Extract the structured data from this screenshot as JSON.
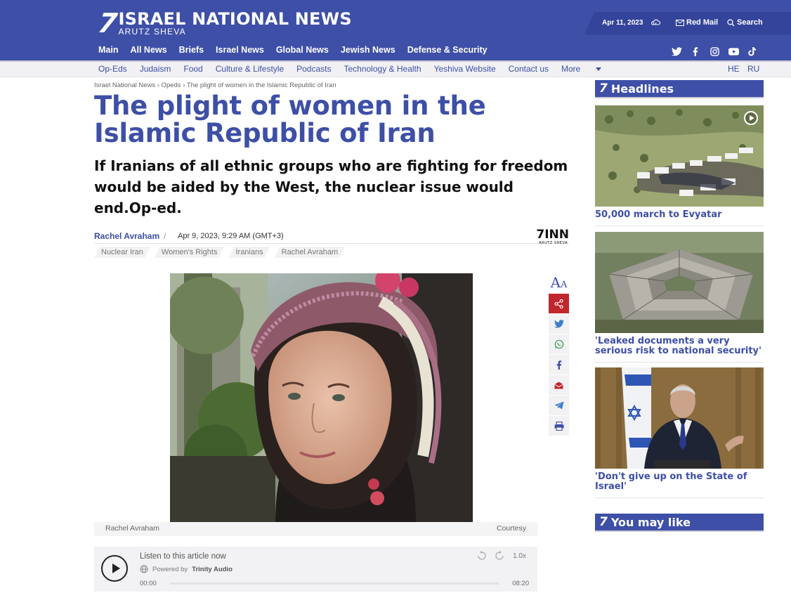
{
  "header": {
    "logo_main": "ISRAEL NATIONAL NEWS",
    "logo_sub": "ARUTZ SHEVA",
    "date": "Apr 11, 2023",
    "red_mail": "Red Mail",
    "search": "Search",
    "brand_color": "#3d4fa6",
    "main_nav": [
      "Main",
      "All News",
      "Briefs",
      "Israel News",
      "Global News",
      "Jewish News",
      "Defense & Security"
    ],
    "socials": [
      "twitter-icon",
      "facebook-icon",
      "instagram-icon",
      "youtube-icon",
      "tiktok-icon"
    ]
  },
  "subnav": {
    "items": [
      "Op-Eds",
      "Judaism",
      "Food",
      "Culture & Lifestyle",
      "Podcasts",
      "Technology & Health",
      "Yeshiva Website",
      "Contact us",
      "More"
    ],
    "lang_he": "HE",
    "lang_ru": "RU"
  },
  "article": {
    "breadcrumb": "Israel National News › Opeds › The plight of women in the Islamic Republic of Iran",
    "title": "The plight of women in the Islamic Republic of Iran",
    "subtitle": "If Iranians of all ethnic groups who are fighting for freedom would be aided by the West, the nuclear issue would end.Op-ed.",
    "author": "Rachel Avraham",
    "author_sep": "/",
    "date": "Apr 9, 2023, 9:29 AM (GMT+3)",
    "inn_logo": "7INN",
    "inn_logo_sub": "ARUTZ SHEVA",
    "tags": [
      "Nuclear Iran",
      "Women's Rights",
      "Iranians",
      "Rachel Avraham"
    ],
    "caption_left": "Rachel Avraham",
    "caption_right": "Courtesy"
  },
  "audio": {
    "title": "Listen to this article now",
    "powered_prefix": "Powered by",
    "powered_brand": "Trinity Audio",
    "start_time": "00:00",
    "end_time": "08:20",
    "speed": "1.0x",
    "progress": 0
  },
  "share": {
    "font_big": "A",
    "font_small": "A",
    "share_color": "#c0272d"
  },
  "sidebar": {
    "headlines_label": "Headlines",
    "seven": "7",
    "you_may_like_label": "You may like",
    "cards": [
      {
        "title": "50,000 march to Evyatar"
      },
      {
        "title": "'Leaked documents a very serious risk to national security'"
      },
      {
        "title": "'Don't give up on the State of Israel'"
      }
    ]
  }
}
